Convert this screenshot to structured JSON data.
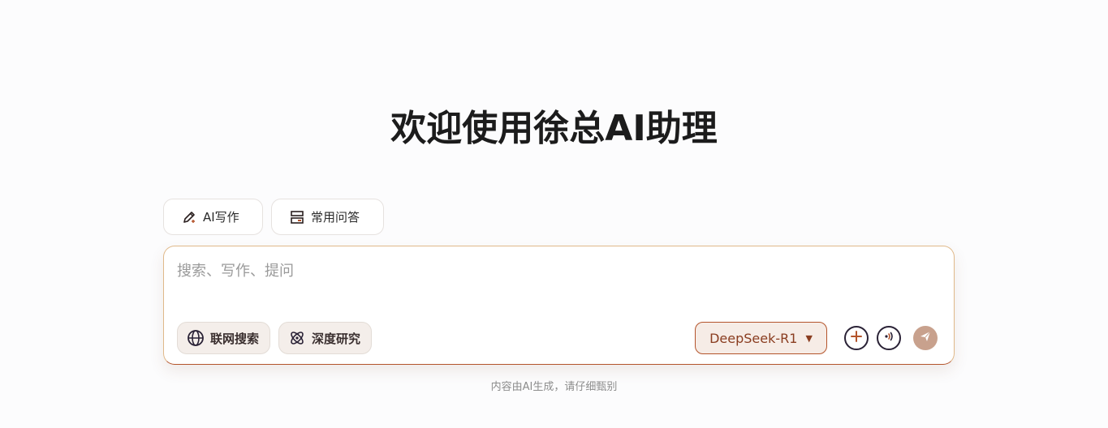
{
  "header": {
    "title": "欢迎使用徐总AI助理"
  },
  "quick_actions": [
    {
      "label": "AI写作",
      "icon": "pen-sparkle-icon"
    },
    {
      "label": "常用问答",
      "icon": "layout-icon"
    }
  ],
  "composer": {
    "placeholder": "搜索、写作、提问",
    "value": "",
    "chips": [
      {
        "label": "联网搜索",
        "icon": "globe-icon"
      },
      {
        "label": "深度研究",
        "icon": "atom-icon"
      }
    ],
    "model": {
      "selected": "DeepSeek-R1",
      "caret": "▼"
    },
    "actions": [
      {
        "name": "attach",
        "icon": "plus-icon"
      },
      {
        "name": "voice",
        "icon": "voice-icon"
      },
      {
        "name": "send",
        "icon": "send-icon"
      }
    ]
  },
  "footer": {
    "note": "内容由AI生成，请仔细甄别"
  },
  "colors": {
    "accent": "#b4542b",
    "send": "#c8a18d",
    "chip_bg": "#f4eeea"
  }
}
